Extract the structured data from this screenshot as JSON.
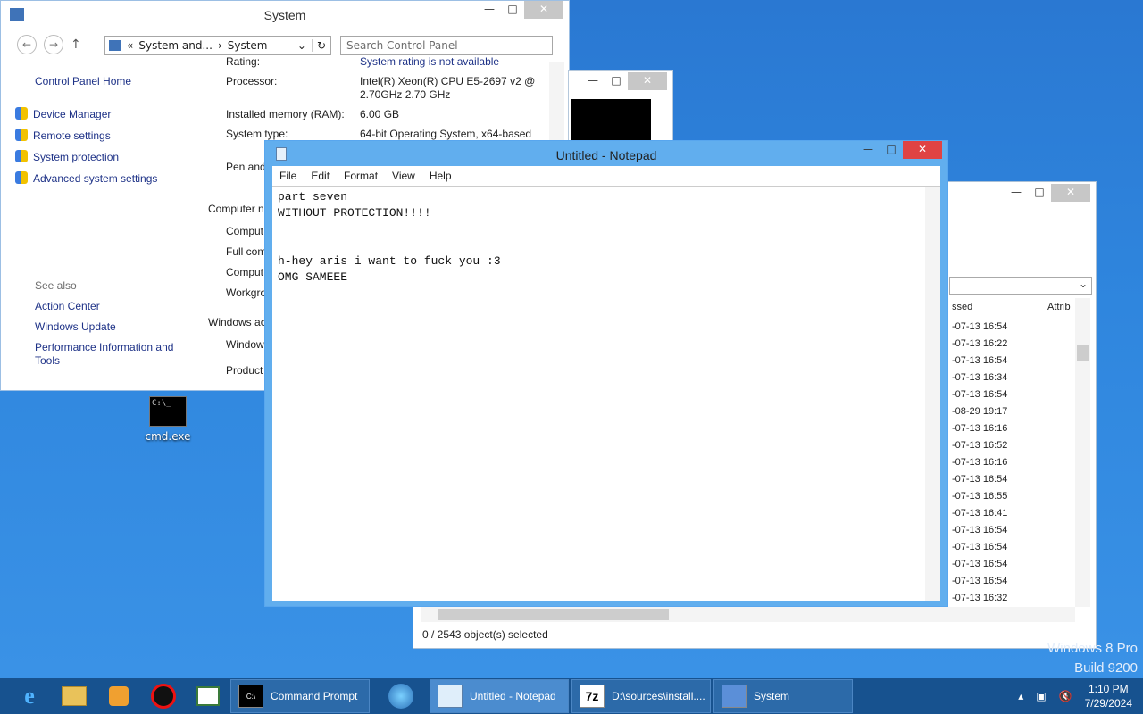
{
  "system_window": {
    "title": "System",
    "breadcrumb": [
      "System and...",
      "System"
    ],
    "search_placeholder": "Search Control Panel",
    "home_link": "Control Panel Home",
    "sidebar_links": [
      "Device Manager",
      "Remote settings",
      "System protection",
      "Advanced system settings"
    ],
    "see_also_heading": "See also",
    "see_also_links": [
      "Action Center",
      "Windows Update",
      "Performance Information and Tools"
    ],
    "rating_label": "Rating:",
    "rating_value": "System rating is not available",
    "processor_label": "Processor:",
    "processor_value": "Intel(R) Xeon(R) CPU E5-2697 v2 @ 2.70GHz   2.70 GHz",
    "ram_label": "Installed memory (RAM):",
    "ram_value": "6.00 GB",
    "systype_label": "System type:",
    "systype_value": "64-bit Operating System, x64-based",
    "pen_label": "Pen and",
    "computer_section": "Computer n",
    "comp_rows": [
      "Comput",
      "Full com",
      "Comput",
      "Workgro"
    ],
    "windows_section": "Windows ac",
    "win_rows": [
      "Window",
      "Product"
    ]
  },
  "explorer_window": {
    "col_accessed": "ssed",
    "col_attrib": "Attrib",
    "dates": [
      "-07-13 16:54",
      "-07-13 16:22",
      "-07-13 16:54",
      "-07-13 16:34",
      "-07-13 16:54",
      "-08-29 19:17",
      "-07-13 16:16",
      "-07-13 16:52",
      "-07-13 16:16",
      "-07-13 16:54",
      "-07-13 16:55",
      "-07-13 16:41",
      "-07-13 16:54",
      "-07-13 16:54",
      "-07-13 16:54",
      "-07-13 16:54",
      "-07-13 16:32"
    ],
    "status": "0 / 2543 object(s) selected"
  },
  "notepad": {
    "title": "Untitled - Notepad",
    "menu": [
      "File",
      "Edit",
      "Format",
      "View",
      "Help"
    ],
    "content": "part seven\nWITHOUT PROTECTION!!!!\n\n\nh-hey aris i want to fuck you :3\nOMG SAMEEE"
  },
  "desktop_icon": {
    "label": "cmd.exe"
  },
  "watermark": {
    "line1": "Windows 8 Pro",
    "line2": "Build 9200"
  },
  "taskbar": {
    "buttons": [
      "Command Prompt",
      "Untitled - Notepad",
      "D:\\sources\\install....",
      "System"
    ],
    "time": "1:10 PM",
    "date": "7/29/2024"
  },
  "colors": {
    "desktop": "#2f86de",
    "taskbar": "#17528f",
    "notepad_frame": "#61aeee",
    "close_active": "#e04343"
  }
}
